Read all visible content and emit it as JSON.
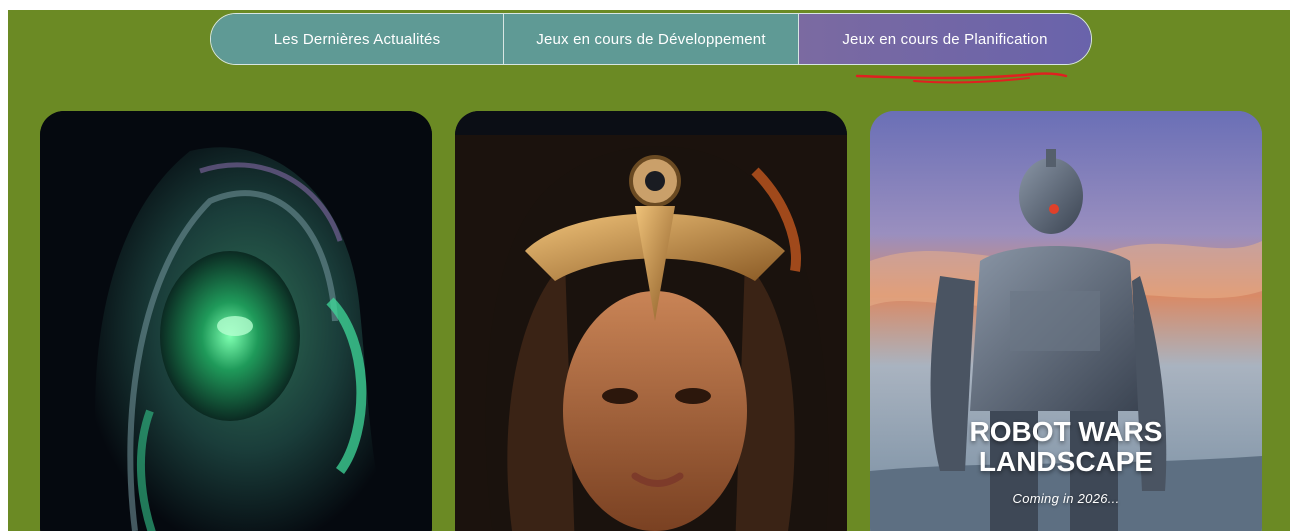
{
  "nav": {
    "tabs": [
      {
        "label": "Les Dernières Actualités"
      },
      {
        "label": "Jeux en cours de Développement"
      },
      {
        "label": "Jeux en cours de Planification"
      }
    ],
    "active_index": 2
  },
  "cards": [
    {
      "image": "alien-helmet-figure",
      "title": "",
      "subtitle": ""
    },
    {
      "image": "warrior-woman-headdress",
      "title": "",
      "subtitle": ""
    },
    {
      "image": "giant-robot-sunset",
      "title": "ROBOT WARS LANDSCAPE",
      "subtitle": "Coming in 2026..."
    }
  ],
  "colors": {
    "page_background": "#6b8a24",
    "tab_background": "#5f9a95",
    "tab_active_background": "#7468a6",
    "annotation_underline": "#e02020"
  }
}
